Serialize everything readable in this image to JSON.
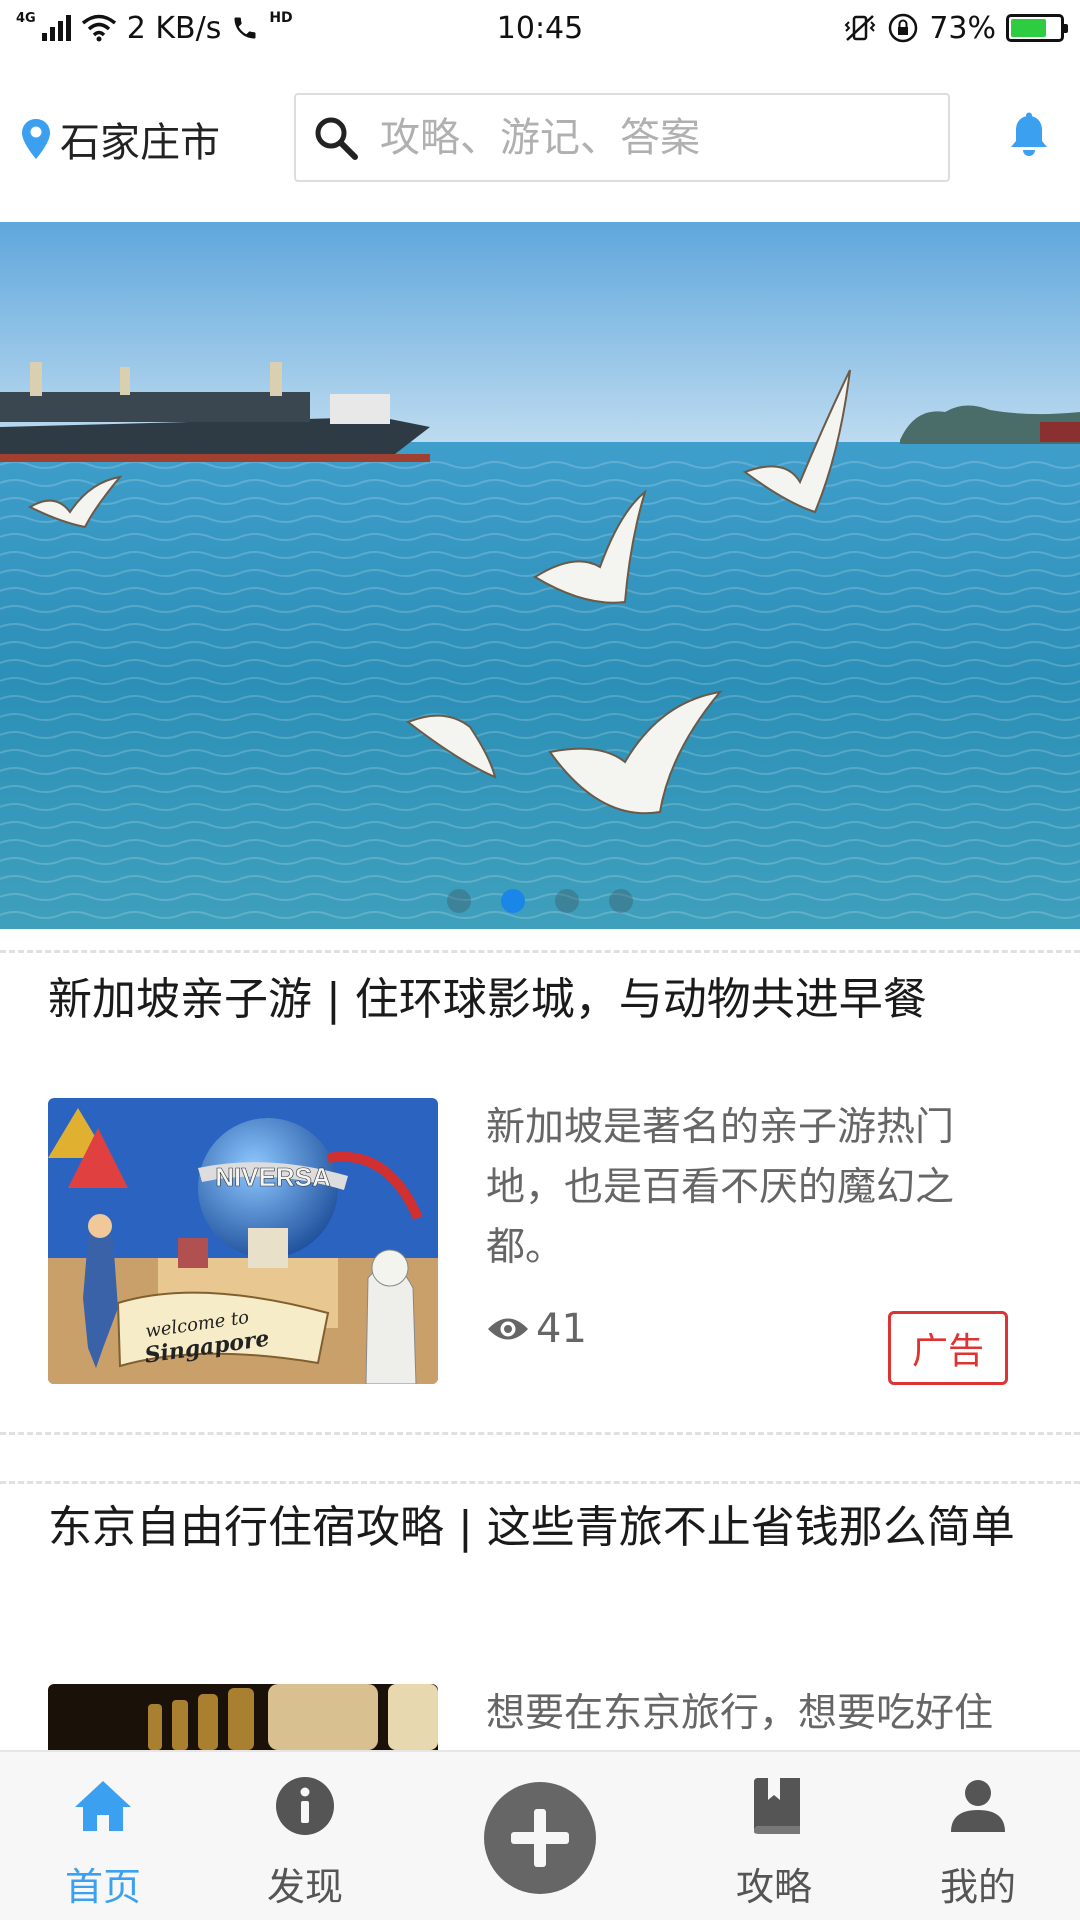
{
  "status_bar": {
    "network_type": "4G",
    "speed": "2 KB/s",
    "hd_label": "HD",
    "time": "10:45",
    "battery_percent": "73%",
    "battery_level": 0.73
  },
  "header": {
    "city": "石家庄市",
    "search_placeholder": "攻略、游记、答案"
  },
  "banner": {
    "slide_count": 4,
    "active_index": 1
  },
  "articles": [
    {
      "title": "新加坡亲子游 | 住环球影城，与动物共进早餐",
      "description": "新加坡是著名的亲子游热门地，也是百看不厌的魔幻之都。",
      "views": "41",
      "ad_label": "广告",
      "thumb_text_line1": "welcome to",
      "thumb_text_line2": "Singapore",
      "thumb_sign": "NIVERSA"
    },
    {
      "title": "东京自由行住宿攻略 | 这些青旅不止省钱那么简单",
      "description": "想要在东京旅行，想要吃好住"
    }
  ],
  "bottom_nav": {
    "items": [
      {
        "label": "首页",
        "icon": "home-icon",
        "active": true
      },
      {
        "label": "发现",
        "icon": "info-icon",
        "active": false
      },
      {
        "label": "",
        "icon": "plus-icon",
        "active": false
      },
      {
        "label": "攻略",
        "icon": "book-icon",
        "active": false
      },
      {
        "label": "我的",
        "icon": "person-icon",
        "active": false
      }
    ]
  },
  "colors": {
    "accent": "#3ba0f0",
    "ad_red": "#dd3333",
    "dot_active": "#1a86e8"
  }
}
